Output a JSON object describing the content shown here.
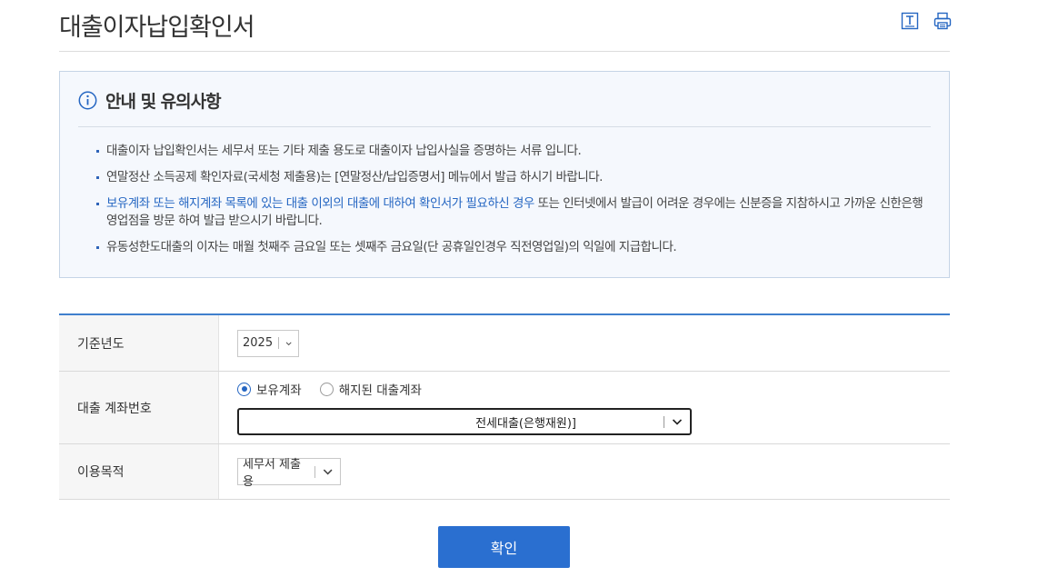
{
  "page": {
    "title": "대출이자납입확인서"
  },
  "toolbar": {
    "text_size_icon": "text-size-icon",
    "print_icon": "print-icon"
  },
  "notice": {
    "title": "안내 및 유의사항",
    "items": [
      {
        "text": "대출이자 납입확인서는 세무서 또는 기타 제출 용도로 대출이자 납입사실을 증명하는 서류 입니다."
      },
      {
        "text": "연말정산 소득공제 확인자료(국세청 제출용)는 [연말정산/납입증명서] 메뉴에서 발급 하시기 바랍니다."
      },
      {
        "highlight": "보유계좌 또는 해지계좌 목록에 있는 대출 이외의 대출에 대하여 확인서가 필요하신 경우",
        "text": " 또는 인터넷에서 발급이 어려운 경우에는 신분증을 지참하시고 가까운 신한은행 영업점을 방문 하여 발급 받으시기 바랍니다."
      },
      {
        "text": "유동성한도대출의 이자는 매월 첫째주 금요일 또는 셋째주 금요일(단 공휴일인경우 직전영업일)의 익일에 지급합니다."
      }
    ]
  },
  "form": {
    "year": {
      "label": "기준년도",
      "value": "2025"
    },
    "account": {
      "label": "대출 계좌번호",
      "radio_owned": "보유계좌",
      "radio_closed": "해지된 대출계좌",
      "selected_radio": "보유계좌",
      "value": "전세대출(은행재원)]"
    },
    "purpose": {
      "label": "이용목적",
      "value": "세무서 제출용"
    }
  },
  "actions": {
    "confirm_label": "확인"
  },
  "colors": {
    "accent": "#2a6fd0",
    "highlight_text": "#2566c2",
    "notice_bg": "#f5f8fd"
  }
}
